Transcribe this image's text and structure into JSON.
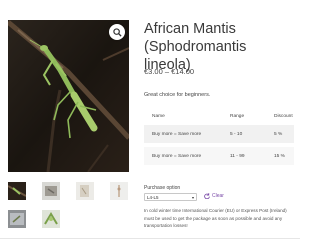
{
  "product": {
    "title": "African Mantis (Sphodromantis lineola)",
    "price_range": "€3.00 – €14.00",
    "description": "Great choice for beginners."
  },
  "gallery": {
    "zoom_icon": "magnifier-icon",
    "thumbnail_count": 6
  },
  "pricing_table": {
    "headers": [
      "Name",
      "Range",
      "Discount"
    ],
    "rows": [
      {
        "name": "Buy more = Save more",
        "range": "5 - 10",
        "discount": "5 %"
      },
      {
        "name": "Buy more = Save more",
        "range": "11 - 99",
        "discount": "15 %"
      }
    ]
  },
  "purchase": {
    "label": "Purchase option",
    "selected": "L4-L5",
    "clear_label": "Clear",
    "notice": "In cold winter time International Courier (EU) or Express Post (Ireland) must be used to get the package as soon as possible and avoid any transportation losses!"
  },
  "colors": {
    "accent": "#7a4aa8",
    "row_bg": "#f1f1f1"
  }
}
